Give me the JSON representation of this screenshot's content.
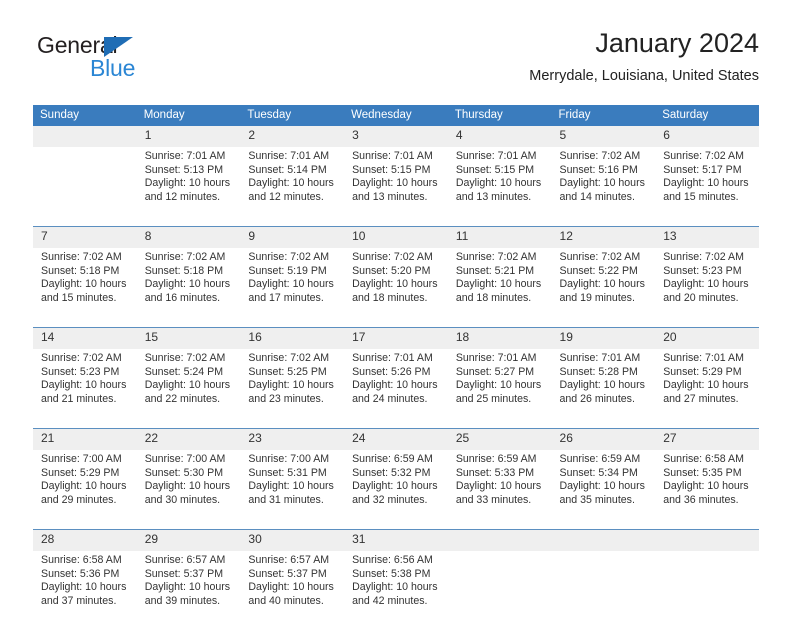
{
  "brand": {
    "name_part1": "General",
    "name_part2": "Blue",
    "triangle_color": "#1f6db5",
    "blue_color": "#2b86d4"
  },
  "header": {
    "title": "January 2024",
    "subtitle": "Merrydale, Louisiana, United States"
  },
  "theme": {
    "header_row_bg": "#3a7cbe",
    "header_row_text": "#ffffff",
    "daynum_band_bg": "#efefef",
    "week_separator": "#5b8fc0"
  },
  "weekday_headers": [
    "Sunday",
    "Monday",
    "Tuesday",
    "Wednesday",
    "Thursday",
    "Friday",
    "Saturday"
  ],
  "weeks": [
    {
      "days": [
        {
          "day": "",
          "sunrise": "",
          "sunset": "",
          "daylight_line1": "",
          "daylight_line2": ""
        },
        {
          "day": "1",
          "sunrise": "Sunrise: 7:01 AM",
          "sunset": "Sunset: 5:13 PM",
          "daylight_line1": "Daylight: 10 hours",
          "daylight_line2": "and 12 minutes."
        },
        {
          "day": "2",
          "sunrise": "Sunrise: 7:01 AM",
          "sunset": "Sunset: 5:14 PM",
          "daylight_line1": "Daylight: 10 hours",
          "daylight_line2": "and 12 minutes."
        },
        {
          "day": "3",
          "sunrise": "Sunrise: 7:01 AM",
          "sunset": "Sunset: 5:15 PM",
          "daylight_line1": "Daylight: 10 hours",
          "daylight_line2": "and 13 minutes."
        },
        {
          "day": "4",
          "sunrise": "Sunrise: 7:01 AM",
          "sunset": "Sunset: 5:15 PM",
          "daylight_line1": "Daylight: 10 hours",
          "daylight_line2": "and 13 minutes."
        },
        {
          "day": "5",
          "sunrise": "Sunrise: 7:02 AM",
          "sunset": "Sunset: 5:16 PM",
          "daylight_line1": "Daylight: 10 hours",
          "daylight_line2": "and 14 minutes."
        },
        {
          "day": "6",
          "sunrise": "Sunrise: 7:02 AM",
          "sunset": "Sunset: 5:17 PM",
          "daylight_line1": "Daylight: 10 hours",
          "daylight_line2": "and 15 minutes."
        }
      ]
    },
    {
      "days": [
        {
          "day": "7",
          "sunrise": "Sunrise: 7:02 AM",
          "sunset": "Sunset: 5:18 PM",
          "daylight_line1": "Daylight: 10 hours",
          "daylight_line2": "and 15 minutes."
        },
        {
          "day": "8",
          "sunrise": "Sunrise: 7:02 AM",
          "sunset": "Sunset: 5:18 PM",
          "daylight_line1": "Daylight: 10 hours",
          "daylight_line2": "and 16 minutes."
        },
        {
          "day": "9",
          "sunrise": "Sunrise: 7:02 AM",
          "sunset": "Sunset: 5:19 PM",
          "daylight_line1": "Daylight: 10 hours",
          "daylight_line2": "and 17 minutes."
        },
        {
          "day": "10",
          "sunrise": "Sunrise: 7:02 AM",
          "sunset": "Sunset: 5:20 PM",
          "daylight_line1": "Daylight: 10 hours",
          "daylight_line2": "and 18 minutes."
        },
        {
          "day": "11",
          "sunrise": "Sunrise: 7:02 AM",
          "sunset": "Sunset: 5:21 PM",
          "daylight_line1": "Daylight: 10 hours",
          "daylight_line2": "and 18 minutes."
        },
        {
          "day": "12",
          "sunrise": "Sunrise: 7:02 AM",
          "sunset": "Sunset: 5:22 PM",
          "daylight_line1": "Daylight: 10 hours",
          "daylight_line2": "and 19 minutes."
        },
        {
          "day": "13",
          "sunrise": "Sunrise: 7:02 AM",
          "sunset": "Sunset: 5:23 PM",
          "daylight_line1": "Daylight: 10 hours",
          "daylight_line2": "and 20 minutes."
        }
      ]
    },
    {
      "days": [
        {
          "day": "14",
          "sunrise": "Sunrise: 7:02 AM",
          "sunset": "Sunset: 5:23 PM",
          "daylight_line1": "Daylight: 10 hours",
          "daylight_line2": "and 21 minutes."
        },
        {
          "day": "15",
          "sunrise": "Sunrise: 7:02 AM",
          "sunset": "Sunset: 5:24 PM",
          "daylight_line1": "Daylight: 10 hours",
          "daylight_line2": "and 22 minutes."
        },
        {
          "day": "16",
          "sunrise": "Sunrise: 7:02 AM",
          "sunset": "Sunset: 5:25 PM",
          "daylight_line1": "Daylight: 10 hours",
          "daylight_line2": "and 23 minutes."
        },
        {
          "day": "17",
          "sunrise": "Sunrise: 7:01 AM",
          "sunset": "Sunset: 5:26 PM",
          "daylight_line1": "Daylight: 10 hours",
          "daylight_line2": "and 24 minutes."
        },
        {
          "day": "18",
          "sunrise": "Sunrise: 7:01 AM",
          "sunset": "Sunset: 5:27 PM",
          "daylight_line1": "Daylight: 10 hours",
          "daylight_line2": "and 25 minutes."
        },
        {
          "day": "19",
          "sunrise": "Sunrise: 7:01 AM",
          "sunset": "Sunset: 5:28 PM",
          "daylight_line1": "Daylight: 10 hours",
          "daylight_line2": "and 26 minutes."
        },
        {
          "day": "20",
          "sunrise": "Sunrise: 7:01 AM",
          "sunset": "Sunset: 5:29 PM",
          "daylight_line1": "Daylight: 10 hours",
          "daylight_line2": "and 27 minutes."
        }
      ]
    },
    {
      "days": [
        {
          "day": "21",
          "sunrise": "Sunrise: 7:00 AM",
          "sunset": "Sunset: 5:29 PM",
          "daylight_line1": "Daylight: 10 hours",
          "daylight_line2": "and 29 minutes."
        },
        {
          "day": "22",
          "sunrise": "Sunrise: 7:00 AM",
          "sunset": "Sunset: 5:30 PM",
          "daylight_line1": "Daylight: 10 hours",
          "daylight_line2": "and 30 minutes."
        },
        {
          "day": "23",
          "sunrise": "Sunrise: 7:00 AM",
          "sunset": "Sunset: 5:31 PM",
          "daylight_line1": "Daylight: 10 hours",
          "daylight_line2": "and 31 minutes."
        },
        {
          "day": "24",
          "sunrise": "Sunrise: 6:59 AM",
          "sunset": "Sunset: 5:32 PM",
          "daylight_line1": "Daylight: 10 hours",
          "daylight_line2": "and 32 minutes."
        },
        {
          "day": "25",
          "sunrise": "Sunrise: 6:59 AM",
          "sunset": "Sunset: 5:33 PM",
          "daylight_line1": "Daylight: 10 hours",
          "daylight_line2": "and 33 minutes."
        },
        {
          "day": "26",
          "sunrise": "Sunrise: 6:59 AM",
          "sunset": "Sunset: 5:34 PM",
          "daylight_line1": "Daylight: 10 hours",
          "daylight_line2": "and 35 minutes."
        },
        {
          "day": "27",
          "sunrise": "Sunrise: 6:58 AM",
          "sunset": "Sunset: 5:35 PM",
          "daylight_line1": "Daylight: 10 hours",
          "daylight_line2": "and 36 minutes."
        }
      ]
    },
    {
      "days": [
        {
          "day": "28",
          "sunrise": "Sunrise: 6:58 AM",
          "sunset": "Sunset: 5:36 PM",
          "daylight_line1": "Daylight: 10 hours",
          "daylight_line2": "and 37 minutes."
        },
        {
          "day": "29",
          "sunrise": "Sunrise: 6:57 AM",
          "sunset": "Sunset: 5:37 PM",
          "daylight_line1": "Daylight: 10 hours",
          "daylight_line2": "and 39 minutes."
        },
        {
          "day": "30",
          "sunrise": "Sunrise: 6:57 AM",
          "sunset": "Sunset: 5:37 PM",
          "daylight_line1": "Daylight: 10 hours",
          "daylight_line2": "and 40 minutes."
        },
        {
          "day": "31",
          "sunrise": "Sunrise: 6:56 AM",
          "sunset": "Sunset: 5:38 PM",
          "daylight_line1": "Daylight: 10 hours",
          "daylight_line2": "and 42 minutes."
        },
        {
          "day": "",
          "sunrise": "",
          "sunset": "",
          "daylight_line1": "",
          "daylight_line2": ""
        },
        {
          "day": "",
          "sunrise": "",
          "sunset": "",
          "daylight_line1": "",
          "daylight_line2": ""
        },
        {
          "day": "",
          "sunrise": "",
          "sunset": "",
          "daylight_line1": "",
          "daylight_line2": ""
        }
      ]
    }
  ]
}
